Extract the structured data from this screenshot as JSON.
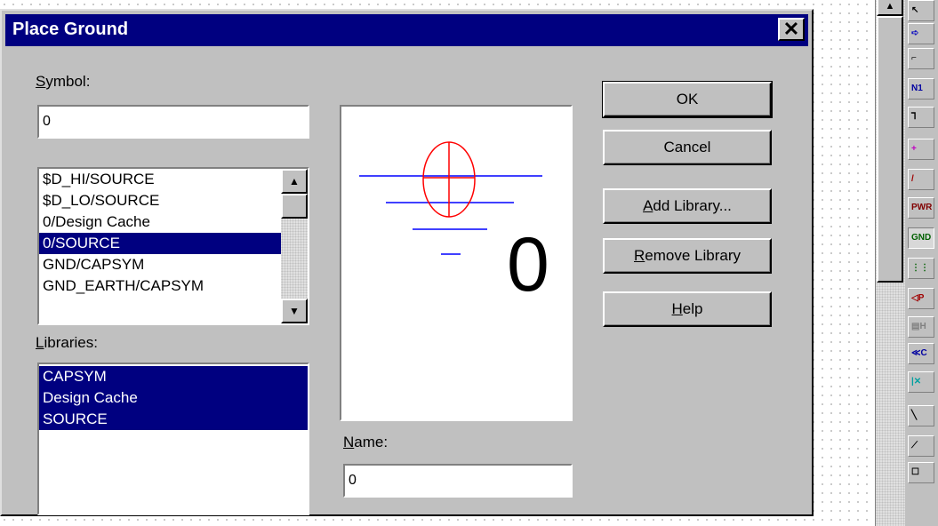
{
  "dialog": {
    "title": "Place Ground",
    "close_glyph": "✕",
    "symbol": {
      "label_first": "S",
      "label_rest": "ymbol:",
      "value": "0",
      "options": [
        "$D_HI/SOURCE",
        "$D_LO/SOURCE",
        "0/Design Cache",
        "0/SOURCE",
        "GND/CAPSYM",
        "GND_EARTH/CAPSYM"
      ],
      "selected": "0/SOURCE"
    },
    "libraries": {
      "label_first": "L",
      "label_mid": "i",
      "label_rest": "braries:",
      "items": [
        "CAPSYM",
        "Design Cache",
        "SOURCE"
      ]
    },
    "preview": {
      "symbol_text": "0"
    },
    "name": {
      "label_first": "N",
      "label_rest": "ame:",
      "value": "0"
    },
    "buttons": {
      "ok": "OK",
      "cancel": "Cancel",
      "add_library_first": "A",
      "add_library_rest": "dd Library...",
      "remove_library_first": "R",
      "remove_library_rest": "emove Library",
      "help_first": "H",
      "help_rest": "elp"
    }
  },
  "toolbar": {
    "tools": [
      {
        "icon": "select-arrow-icon",
        "text": "↖"
      },
      {
        "icon": "place-part-icon",
        "text": "➪"
      },
      {
        "icon": "place-wire-icon",
        "text": "⌐"
      },
      {
        "icon": "net-alias-icon",
        "text": "N1"
      },
      {
        "icon": "place-bus-icon",
        "text": "⅂"
      },
      {
        "icon": "junction-icon",
        "text": "+"
      },
      {
        "icon": "bus-entry-icon",
        "text": "/"
      },
      {
        "icon": "power-icon",
        "text": "PWR"
      },
      {
        "icon": "ground-icon",
        "text": "GND"
      },
      {
        "icon": "hierarchical-block-icon",
        "text": "⋮⋮"
      },
      {
        "icon": "hierarchical-port-icon",
        "text": "◁P"
      },
      {
        "icon": "hierarchical-pin-icon",
        "text": "▤H"
      },
      {
        "icon": "off-page-connector-icon",
        "text": "≪C"
      },
      {
        "icon": "no-connect-icon",
        "text": "|✕"
      },
      {
        "icon": "place-line-icon",
        "text": "╲"
      },
      {
        "icon": "place-polyline-icon",
        "text": "⟋"
      },
      {
        "icon": "place-rectangle-icon",
        "text": "☐"
      }
    ]
  }
}
